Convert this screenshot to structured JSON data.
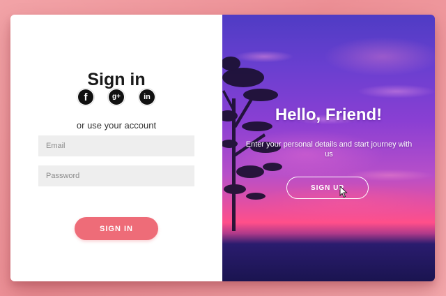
{
  "signin": {
    "title": "Sign in",
    "social": [
      {
        "name": "facebook",
        "glyph": "f",
        "icon": "facebook-icon"
      },
      {
        "name": "google-plus",
        "glyph": "g+",
        "icon": "google-plus-icon"
      },
      {
        "name": "linkedin",
        "glyph": "in",
        "icon": "linkedin-icon"
      }
    ],
    "subtitle": "or use your account",
    "email_placeholder": "Email",
    "password_placeholder": "Password",
    "button_label": "SIGN IN"
  },
  "overlay": {
    "title": "Hello, Friend!",
    "description": "Enter your personal details and start journey with us",
    "button_label": "SIGN UP"
  },
  "colors": {
    "accent": "#ee6c78",
    "background": "#ec8f95"
  }
}
